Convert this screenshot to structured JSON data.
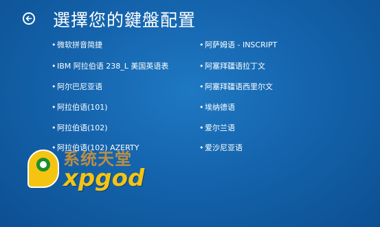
{
  "header": {
    "title": "選擇您的鍵盤配置",
    "back_icon": "back-arrow-icon"
  },
  "keyboard_layouts": {
    "left": [
      {
        "label": "微软拼音简捷"
      },
      {
        "label": "IBM 阿拉伯语 238_L 美国英语表"
      },
      {
        "label": "阿尔巴尼亚语"
      },
      {
        "label": "阿拉伯语(101)"
      },
      {
        "label": "阿拉伯语(102)"
      },
      {
        "label": "阿拉伯语(102) AZERTY"
      }
    ],
    "right": [
      {
        "label": "阿萨姆语 - INSCRIPT"
      },
      {
        "label": "阿塞拜疆语拉丁文"
      },
      {
        "label": "阿塞拜疆语西里尔文"
      },
      {
        "label": "埃纳德语"
      },
      {
        "label": "爱尔兰语"
      },
      {
        "label": "爱沙尼亚语"
      }
    ]
  },
  "bullet": "•",
  "watermark": {
    "text_cn": "系统天堂",
    "text_en": "xpgod",
    "logo_color": "#f4c411",
    "accent_color": "#1b8f2f"
  },
  "colors": {
    "background": "#1464ad",
    "text": "#ffffff"
  }
}
